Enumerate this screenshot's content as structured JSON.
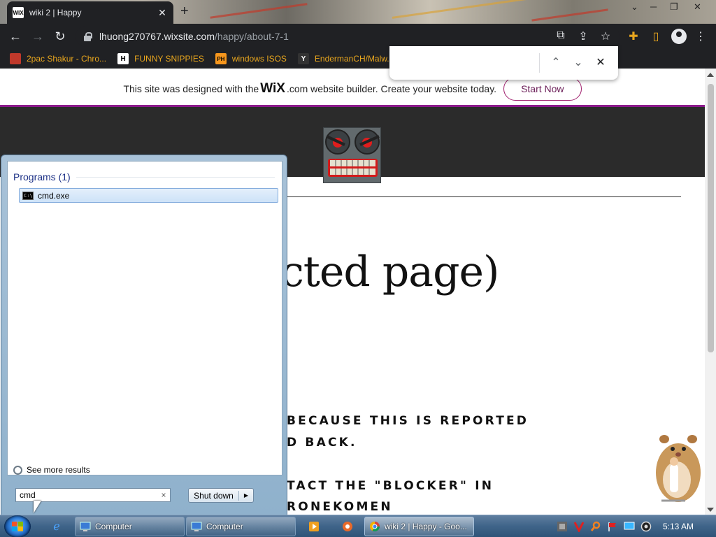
{
  "browser": {
    "tab": {
      "favicon": "WIX",
      "title": "wiki 2 | Happy",
      "close": "✕"
    },
    "newtab": "+",
    "window_controls": [
      "⌄",
      "─",
      "❐",
      "✕"
    ],
    "address": {
      "domain": "lhuong270767.wixsite.com",
      "path": "/happy/about-7-1"
    },
    "bookmarks": [
      {
        "icon": "tupac-icon",
        "glyph": "",
        "label": "2pac Shakur - Chro..."
      },
      {
        "icon": "h-letter-icon",
        "glyph": "H",
        "label": "FUNNY SNIPPIES"
      },
      {
        "icon": "ph-icon",
        "glyph": "PH",
        "label": "windows ISOS"
      },
      {
        "icon": "youtube-icon",
        "glyph": "Y",
        "label": "EndermanCH/Malw..."
      }
    ],
    "find": {
      "value": "",
      "prev": "⌃",
      "next": "⌄",
      "close": "✕"
    }
  },
  "page": {
    "banner": {
      "pre": "This site was designed with the",
      "brand": "WiX",
      "post": ".com website builder. Create your website today.",
      "cta": "Start Now"
    },
    "title": "icted page)",
    "lines": [
      "BECAUSE THIS IS REPORTED",
      "D BACK.",
      "TACT THE \"BLOCKER\" IN",
      "RONEKOMEN"
    ]
  },
  "start_menu": {
    "heading": "Programs (1)",
    "result": "cmd.exe",
    "result_icon_text": "C:\\",
    "see_more": "See more results",
    "search_value": "cmd",
    "clear": "×",
    "shutdown": "Shut down",
    "shutdown_arrow": "▶"
  },
  "taskbar": {
    "buttons": [
      {
        "label": "Computer"
      },
      {
        "label": "Computer"
      },
      {
        "label": "wiki 2 | Happy - Goo..."
      }
    ],
    "clock": "5:13 AM"
  },
  "colors": {
    "accent": "#8b1a8b",
    "chrome_dark": "#202124",
    "bookmark_text": "#e8a61e"
  }
}
